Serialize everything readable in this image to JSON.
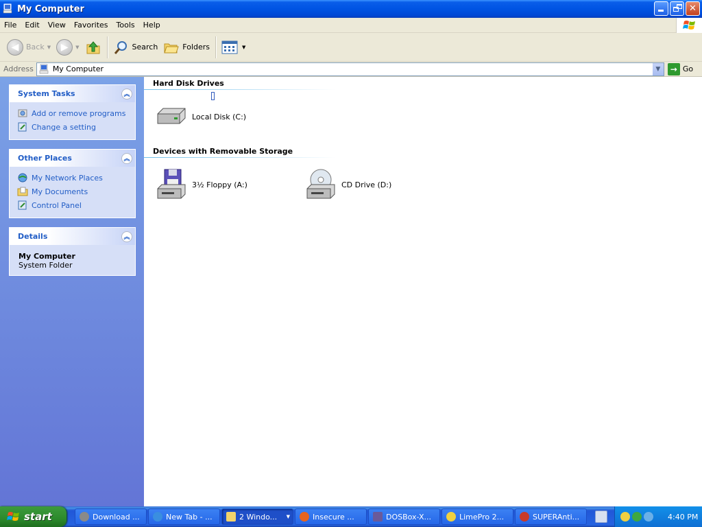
{
  "window": {
    "title": "My Computer"
  },
  "menubar": {
    "items": [
      "File",
      "Edit",
      "View",
      "Favorites",
      "Tools",
      "Help"
    ]
  },
  "toolbar": {
    "back_label": "Back",
    "search_label": "Search",
    "folders_label": "Folders"
  },
  "addressbar": {
    "label": "Address",
    "value": "My Computer",
    "go_label": "Go"
  },
  "sidebar": {
    "system_tasks": {
      "title": "System Tasks",
      "items": [
        "Add or remove programs",
        "Change a setting"
      ]
    },
    "other_places": {
      "title": "Other Places",
      "items": [
        "My Network Places",
        "My Documents",
        "Control Panel"
      ]
    },
    "details": {
      "title": "Details",
      "name": "My Computer",
      "type": "System Folder"
    }
  },
  "main": {
    "groups": [
      {
        "title": "Hard Disk Drives",
        "items": [
          "Local Disk (C:)"
        ]
      },
      {
        "title": "Devices with Removable Storage",
        "items": [
          "3½ Floppy (A:)",
          "CD Drive (D:)"
        ]
      }
    ]
  },
  "taskbar": {
    "start_label": "start",
    "buttons": [
      "Download ...",
      "New Tab - ...",
      "2 Windo...",
      "Insecure ...",
      "DOSBox-X...",
      "LimePro 2...",
      "SUPERAnti..."
    ],
    "clock": "4:40 PM"
  },
  "colors": {
    "titlebar": "#0054e3",
    "task_link": "#215dc6",
    "left_pane": "#7ba2e7",
    "start": "#3c9a3c"
  }
}
